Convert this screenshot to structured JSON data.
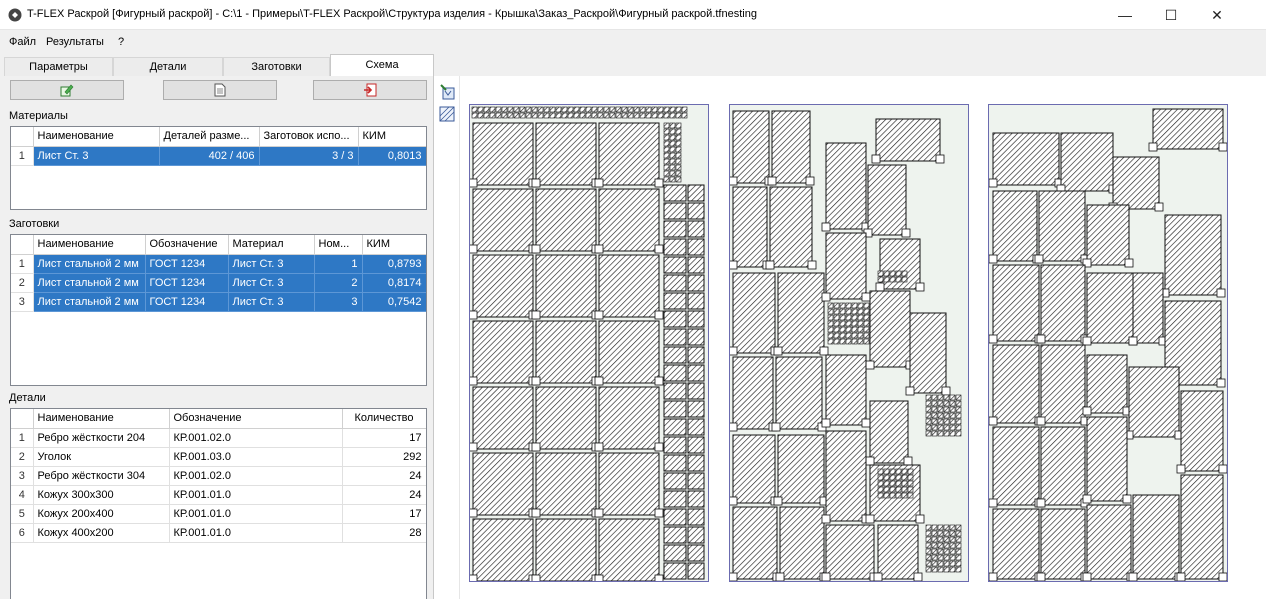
{
  "window": {
    "title": "T-FLEX Раскрой [Фигурный раскрой] - C:\\1 - Примеры\\T-FLEX Раскрой\\Структура изделия - Крышка\\Заказ_Раскрой\\Фигурный раскрой.tfnesting",
    "minimize": "—",
    "maximize": "☐",
    "close": "✕"
  },
  "menu": [
    "Файл",
    "Результаты",
    "?"
  ],
  "tabs": [
    "Параметры",
    "Детали",
    "Заготовки",
    "Схема"
  ],
  "active_tab": "Схема",
  "toolbar": {
    "icons": [
      "edit-sheet-icon",
      "document-icon",
      "export-icon"
    ]
  },
  "materials": {
    "title": "Материалы",
    "columns": [
      "Наименование",
      "Деталей разме...",
      "Заготовок испо...",
      "КИМ"
    ],
    "rows": [
      {
        "idx": "1",
        "name": "Лист Ст. 3",
        "parts": "402 / 406",
        "blanks": "3 / 3",
        "kim": "0,8013"
      }
    ]
  },
  "blanks": {
    "title": "Заготовки",
    "columns": [
      "Наименование",
      "Обозначение",
      "Материал",
      "Ном...",
      "КИМ"
    ],
    "rows": [
      {
        "idx": "1",
        "name": "Лист стальной 2 мм",
        "designation": "ГОСТ 1234",
        "material": "Лист Ст. 3",
        "num": "1",
        "kim": "0,8793"
      },
      {
        "idx": "2",
        "name": "Лист стальной 2 мм",
        "designation": "ГОСТ 1234",
        "material": "Лист Ст. 3",
        "num": "2",
        "kim": "0,8174"
      },
      {
        "idx": "3",
        "name": "Лист стальной 2 мм",
        "designation": "ГОСТ 1234",
        "material": "Лист Ст. 3",
        "num": "3",
        "kim": "0,7542"
      }
    ]
  },
  "parts": {
    "title": "Детали",
    "columns": [
      "Наименование",
      "Обозначение",
      "Количество"
    ],
    "rows": [
      {
        "idx": "1",
        "name": "Ребро жёсткости 204",
        "designation": "КР.001.02.0",
        "qty": "17"
      },
      {
        "idx": "2",
        "name": "Уголок",
        "designation": "КР.001.03.0",
        "qty": "292"
      },
      {
        "idx": "3",
        "name": "Ребро жёсткости 304",
        "designation": "КР.001.02.0",
        "qty": "24"
      },
      {
        "idx": "4",
        "name": "Кожух 300x300",
        "designation": "КР.001.01.0",
        "qty": "24"
      },
      {
        "idx": "5",
        "name": "Кожух 200x400",
        "designation": "КР.001.01.0",
        "qty": "17"
      },
      {
        "idx": "6",
        "name": "Кожух 400x200",
        "designation": "КР.001.01.0",
        "qty": "28"
      }
    ]
  },
  "scheme": {
    "tools": [
      "zoom-fit-icon",
      "layout-view-icon"
    ],
    "sheets": [
      {
        "name": "sheet-1",
        "layout": "dense"
      },
      {
        "name": "sheet-2",
        "layout": "mixed"
      },
      {
        "name": "sheet-3",
        "layout": "sparse"
      }
    ]
  },
  "colors": {
    "selection": "#2e78c5",
    "sheet_border": "#6b6bb0",
    "sheet_fill": "#eef3ee",
    "part_hatch": "#222222"
  }
}
